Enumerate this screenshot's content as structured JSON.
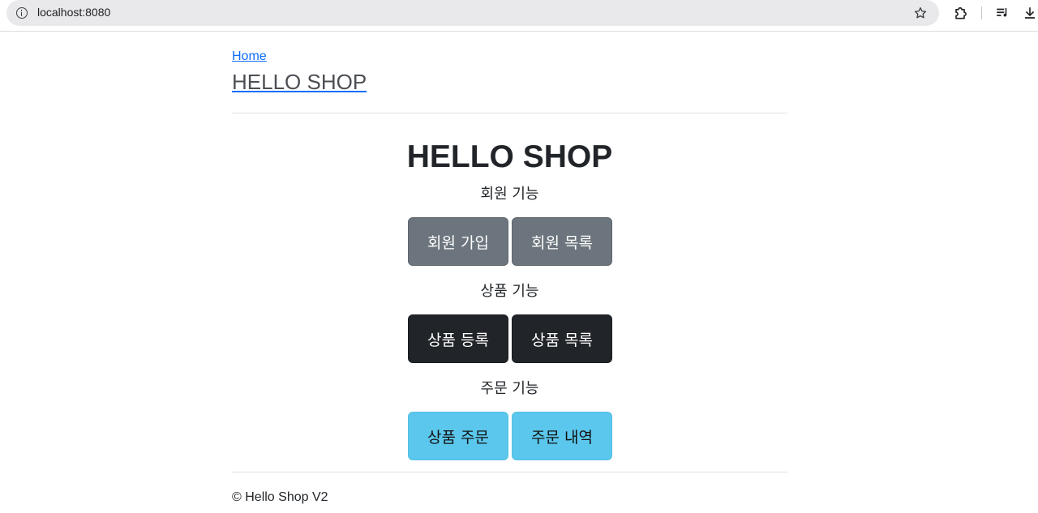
{
  "browser": {
    "url": "localhost:8080",
    "icons": [
      "info-icon",
      "star-icon",
      "extensions-icon",
      "media-icon",
      "download-icon"
    ]
  },
  "header": {
    "home_link": "Home",
    "brand": "HELLO SHOP"
  },
  "main": {
    "title": "HELLO SHOP",
    "sections": [
      {
        "label": "회원 기능",
        "buttons": [
          "회원 가입",
          "회원 목록"
        ],
        "style": "secondary"
      },
      {
        "label": "상품 기능",
        "buttons": [
          "상품 등록",
          "상품 목록"
        ],
        "style": "dark"
      },
      {
        "label": "주문 기능",
        "buttons": [
          "상품 주문",
          "주문 내역"
        ],
        "style": "info"
      }
    ]
  },
  "footer": {
    "text": "© Hello Shop V2"
  },
  "colors": {
    "link": "#0d6efd",
    "secondary": "#6c757d",
    "dark": "#212529",
    "info": "#5bc7ec"
  }
}
